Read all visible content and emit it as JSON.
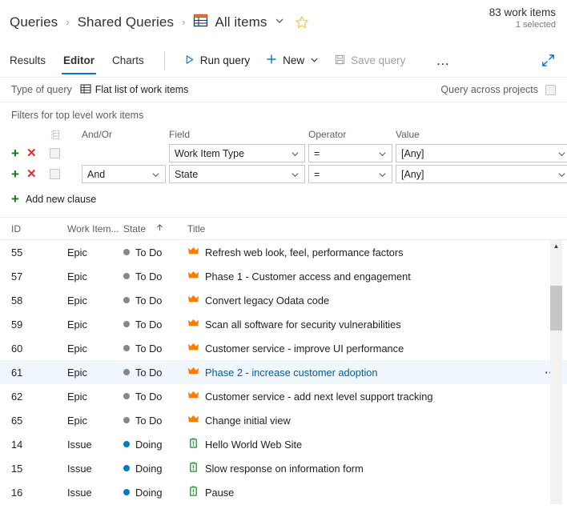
{
  "header": {
    "breadcrumb": [
      {
        "label": "Queries",
        "icon": null
      },
      {
        "label": "Shared Queries",
        "icon": null
      },
      {
        "label": "All items",
        "icon": "grid-icon"
      }
    ],
    "separator": "›",
    "dropdown_icon": "chevron-down-icon",
    "favorite_icon": "star-outline-icon",
    "count_primary": "83 work items",
    "count_secondary": "1 selected"
  },
  "toolbar": {
    "tabs": [
      {
        "label": "Results",
        "active": false
      },
      {
        "label": "Editor",
        "active": true
      },
      {
        "label": "Charts",
        "active": false
      }
    ],
    "run_query_label": "Run query",
    "run_query_icon": "play-triangle-icon",
    "new_label": "New",
    "new_icon": "plus-icon",
    "new_caret_icon": "chevron-down-icon",
    "save_query_label": "Save query",
    "save_query_icon": "save-disk-icon",
    "overflow_label": "…",
    "overflow_icon": "ellipsis-icon",
    "expand_icon": "expand-diagonal-icon",
    "accent_color": "#0078d4"
  },
  "query_type": {
    "label": "Type of query",
    "value": "Flat list of work items",
    "value_icon": "flat-list-grid-icon",
    "across_projects_label": "Query across projects",
    "across_projects_checked": false
  },
  "filters": {
    "section_title": "Filters for top level work items",
    "columns": {
      "drag": "drag-handle-icon",
      "andor": "And/Or",
      "field": "Field",
      "operator": "Operator",
      "value": "Value"
    },
    "rows": [
      {
        "add_icon": "plus-icon",
        "delete_icon": "close-x-icon",
        "checked": false,
        "andor": "",
        "field": "Work Item Type",
        "operator": "=",
        "value": "[Any]"
      },
      {
        "add_icon": "plus-icon",
        "delete_icon": "close-x-icon",
        "checked": false,
        "andor": "And",
        "field": "State",
        "operator": "=",
        "value": "[Any]"
      }
    ],
    "add_clause_label": "Add new clause",
    "add_clause_icon": "plus-icon",
    "plus_color": "#107c10",
    "delete_color": "#d13438"
  },
  "results": {
    "columns": [
      {
        "key": "id",
        "label": "ID",
        "sorted": null
      },
      {
        "key": "type",
        "label": "Work Item...",
        "sorted": null
      },
      {
        "key": "state",
        "label": "State",
        "sorted": "asc",
        "sort_icon": "arrow-up-icon"
      },
      {
        "key": "title",
        "label": "Title",
        "sorted": null
      }
    ],
    "selected_id": "61",
    "row_menu_icon": "ellipsis-icon",
    "rows": [
      {
        "id": "55",
        "type": "Epic",
        "state": "To Do",
        "state_color": "#868686",
        "title": "Refresh web look, feel, performance factors",
        "icon": "crown-icon",
        "icon_color": "#ff7b00",
        "selected": false
      },
      {
        "id": "57",
        "type": "Epic",
        "state": "To Do",
        "state_color": "#868686",
        "title": "Phase 1 - Customer access and engagement",
        "icon": "crown-icon",
        "icon_color": "#ff7b00",
        "selected": false
      },
      {
        "id": "58",
        "type": "Epic",
        "state": "To Do",
        "state_color": "#868686",
        "title": "Convert legacy Odata code",
        "icon": "crown-icon",
        "icon_color": "#ff7b00",
        "selected": false
      },
      {
        "id": "59",
        "type": "Epic",
        "state": "To Do",
        "state_color": "#868686",
        "title": "Scan all software for security vulnerabilities",
        "icon": "crown-icon",
        "icon_color": "#ff7b00",
        "selected": false
      },
      {
        "id": "60",
        "type": "Epic",
        "state": "To Do",
        "state_color": "#868686",
        "title": "Customer service - improve UI performance",
        "icon": "crown-icon",
        "icon_color": "#ff7b00",
        "selected": false
      },
      {
        "id": "61",
        "type": "Epic",
        "state": "To Do",
        "state_color": "#868686",
        "title": "Phase 2 - increase customer adoption",
        "icon": "crown-icon",
        "icon_color": "#ff7b00",
        "selected": true
      },
      {
        "id": "62",
        "type": "Epic",
        "state": "To Do",
        "state_color": "#868686",
        "title": "Customer service - add next level support tracking",
        "icon": "crown-icon",
        "icon_color": "#ff7b00",
        "selected": false
      },
      {
        "id": "65",
        "type": "Epic",
        "state": "To Do",
        "state_color": "#868686",
        "title": "Change initial view",
        "icon": "crown-icon",
        "icon_color": "#ff7b00",
        "selected": false
      },
      {
        "id": "14",
        "type": "Issue",
        "state": "Doing",
        "state_color": "#007acc",
        "title": "Hello World Web Site",
        "icon": "issue-icon",
        "icon_color": "#33a644",
        "selected": false
      },
      {
        "id": "15",
        "type": "Issue",
        "state": "Doing",
        "state_color": "#007acc",
        "title": "Slow response on information form",
        "icon": "issue-icon",
        "icon_color": "#33a644",
        "selected": false
      },
      {
        "id": "16",
        "type": "Issue",
        "state": "Doing",
        "state_color": "#007acc",
        "title": "Pause",
        "icon": "issue-icon",
        "icon_color": "#33a644",
        "selected": false
      }
    ],
    "scrollbar": {
      "up_arrow_icon": "caret-up-icon",
      "thumb_top_pct": 17,
      "thumb_height_pct": 17
    }
  }
}
